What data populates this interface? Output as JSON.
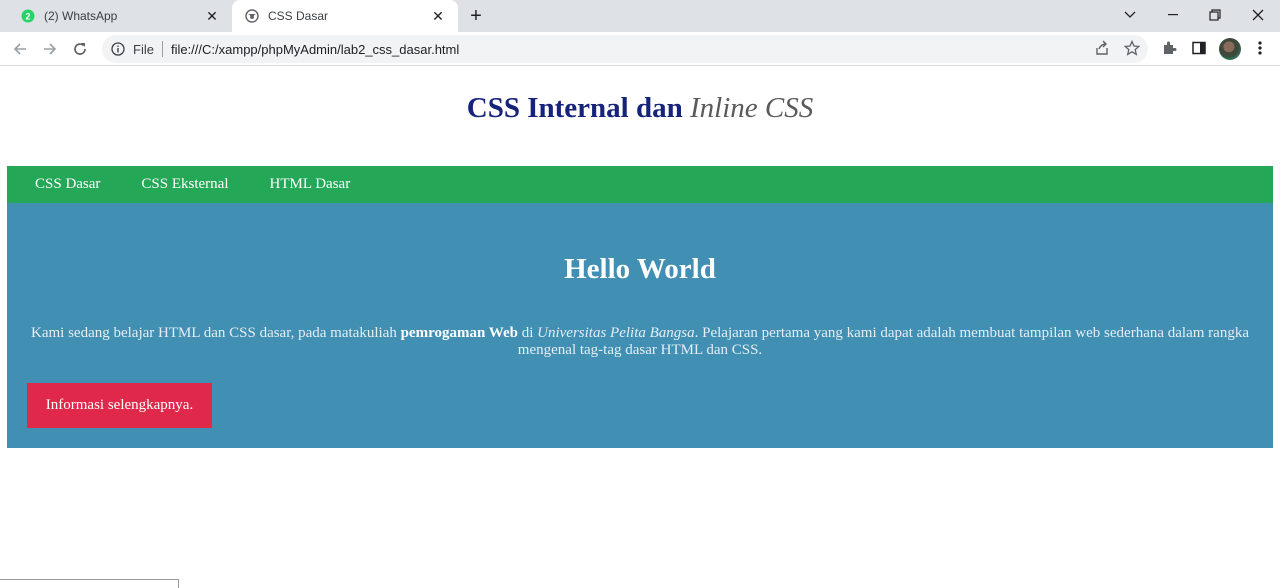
{
  "browser": {
    "tabs": [
      {
        "title": "(2) WhatsApp",
        "badge": "2",
        "active": false
      },
      {
        "title": "CSS Dasar",
        "active": true
      }
    ],
    "new_tab_symbol": "+",
    "address": {
      "scheme_label": "File",
      "url": "file:///C:/xampp/phpMyAdmin/lab2_css_dasar.html"
    }
  },
  "page": {
    "title_bold": "CSS Internal dan ",
    "title_italic": "Inline CSS",
    "nav": [
      "CSS Dasar",
      "CSS Eksternal",
      "HTML Dasar"
    ],
    "hero": {
      "heading": "Hello World",
      "text_before": "Kami sedang belajar HTML dan CSS dasar, pada matakuliah ",
      "text_bold": "pemrogaman Web",
      "text_mid": " di ",
      "text_italic": "Universitas Pelita Bangsa",
      "text_after": ". Pelajaran pertama yang kami dapat adalah membuat tampilan web sederhana dalam rangka mengenal tag-tag dasar HTML dan CSS.",
      "button": "Informasi selengkapnya."
    }
  },
  "colors": {
    "title": "#16237a",
    "nav_bg": "#24a857",
    "hero_bg": "#418fb3",
    "button_bg": "#e0284a",
    "whatsapp_badge": "#25d366"
  }
}
